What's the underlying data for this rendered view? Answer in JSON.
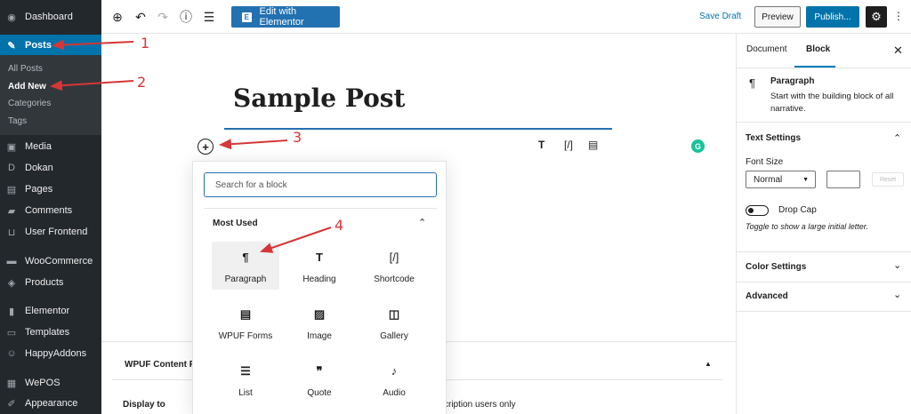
{
  "sidebar": {
    "items": [
      {
        "label": "Dashboard",
        "icon": "dashboard-icon"
      },
      {
        "label": "Posts",
        "icon": "pin-icon"
      },
      {
        "label": "Media",
        "icon": "media-icon"
      },
      {
        "label": "Dokan",
        "icon": "dokan-icon"
      },
      {
        "label": "Pages",
        "icon": "pages-icon"
      },
      {
        "label": "Comments",
        "icon": "comments-icon"
      },
      {
        "label": "User Frontend",
        "icon": "user-frontend-icon"
      },
      {
        "label": "WooCommerce",
        "icon": "woocommerce-icon"
      },
      {
        "label": "Products",
        "icon": "products-icon"
      },
      {
        "label": "Elementor",
        "icon": "elementor-icon"
      },
      {
        "label": "Templates",
        "icon": "templates-icon"
      },
      {
        "label": "HappyAddons",
        "icon": "happyaddons-icon"
      },
      {
        "label": "WePOS",
        "icon": "wepos-icon"
      },
      {
        "label": "Appearance",
        "icon": "appearance-icon"
      }
    ],
    "submenu": [
      "All Posts",
      "Add New",
      "Categories",
      "Tags"
    ]
  },
  "toolbar": {
    "elementor_label": "Edit with Elementor",
    "save_draft": "Save Draft",
    "preview": "Preview",
    "publish": "Publish..."
  },
  "editor": {
    "title": "Sample Post",
    "inline_tools": [
      "T",
      "[/]",
      "▤"
    ]
  },
  "inserter": {
    "search_placeholder": "Search for a block",
    "section_title": "Most Used",
    "blocks": [
      {
        "label": "Paragraph",
        "icon": "¶"
      },
      {
        "label": "Heading",
        "icon": "T"
      },
      {
        "label": "Shortcode",
        "icon": "[/]"
      },
      {
        "label": "WPUF Forms",
        "icon": "▤"
      },
      {
        "label": "Image",
        "icon": "▨"
      },
      {
        "label": "Gallery",
        "icon": "◫"
      },
      {
        "label": "List",
        "icon": "☰"
      },
      {
        "label": "Quote",
        "icon": "❞"
      },
      {
        "label": "Audio",
        "icon": "♪"
      }
    ]
  },
  "meta_box": {
    "title": "WPUF Content R",
    "display_to": "Display to",
    "subscription_text": "scription users only"
  },
  "settings_panel": {
    "tabs": [
      "Document",
      "Block"
    ],
    "block_name": "Paragraph",
    "block_desc": "Start with the building block of all narrative.",
    "text_settings": "Text Settings",
    "font_size_label": "Font Size",
    "font_size_value": "Normal",
    "reset": "Reset",
    "drop_cap": "Drop Cap",
    "drop_cap_help": "Toggle to show a large initial letter.",
    "color_settings": "Color Settings",
    "advanced": "Advanced"
  },
  "annotations": [
    "1",
    "2",
    "3",
    "4"
  ],
  "colors": {
    "admin_sidebar": "#23282d",
    "accent": "#0073aa",
    "annotation_red": "#d63638"
  }
}
